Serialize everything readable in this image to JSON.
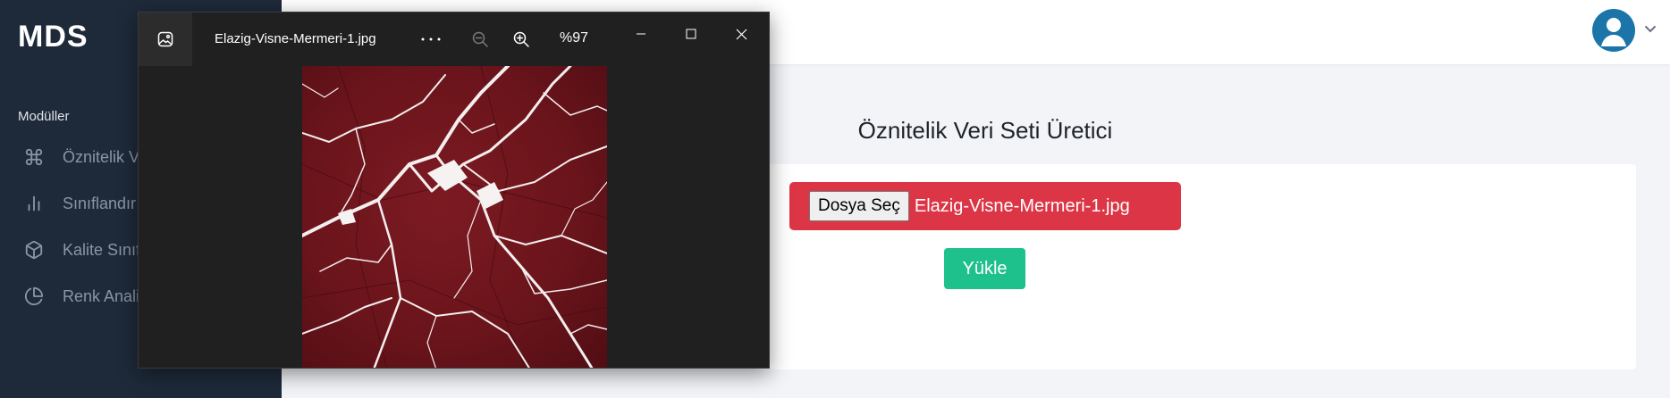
{
  "app": {
    "brand": "MDS"
  },
  "sidebar": {
    "section_label": "Modüller",
    "items": [
      {
        "label": "Öznitelik V",
        "icon": "command-icon"
      },
      {
        "label": "Sınıflandır",
        "icon": "bar-chart-icon"
      },
      {
        "label": "Kalite Sınıf",
        "icon": "cube-icon"
      },
      {
        "label": "Renk Anali",
        "icon": "pie-chart-icon"
      }
    ]
  },
  "topbar": {
    "avatar_icon": "user-avatar-icon",
    "caret_icon": "chevron-down-icon"
  },
  "main": {
    "title": "Öznitelik Veri Seti Üretici",
    "file_input": {
      "button_label": "Dosya Seç",
      "file_name": "Elazig-Visne-Mermeri-1.jpg"
    },
    "upload_label": "Yükle"
  },
  "viewer": {
    "title": "Elazig-Visne-Mermeri-1.jpg",
    "zoom": "%97",
    "more_label": "···",
    "icons": [
      "photos-app-icon",
      "zoom-out-icon",
      "zoom-in-icon",
      "minimize-icon",
      "maximize-icon",
      "close-icon"
    ],
    "image_subject": "red marble with white veins"
  },
  "colors": {
    "sidebar_bg": "#1e2a3a",
    "danger": "#dc3545",
    "success": "#1ec08b",
    "viewer_bg": "#202020",
    "avatar": "#1b75a8"
  }
}
